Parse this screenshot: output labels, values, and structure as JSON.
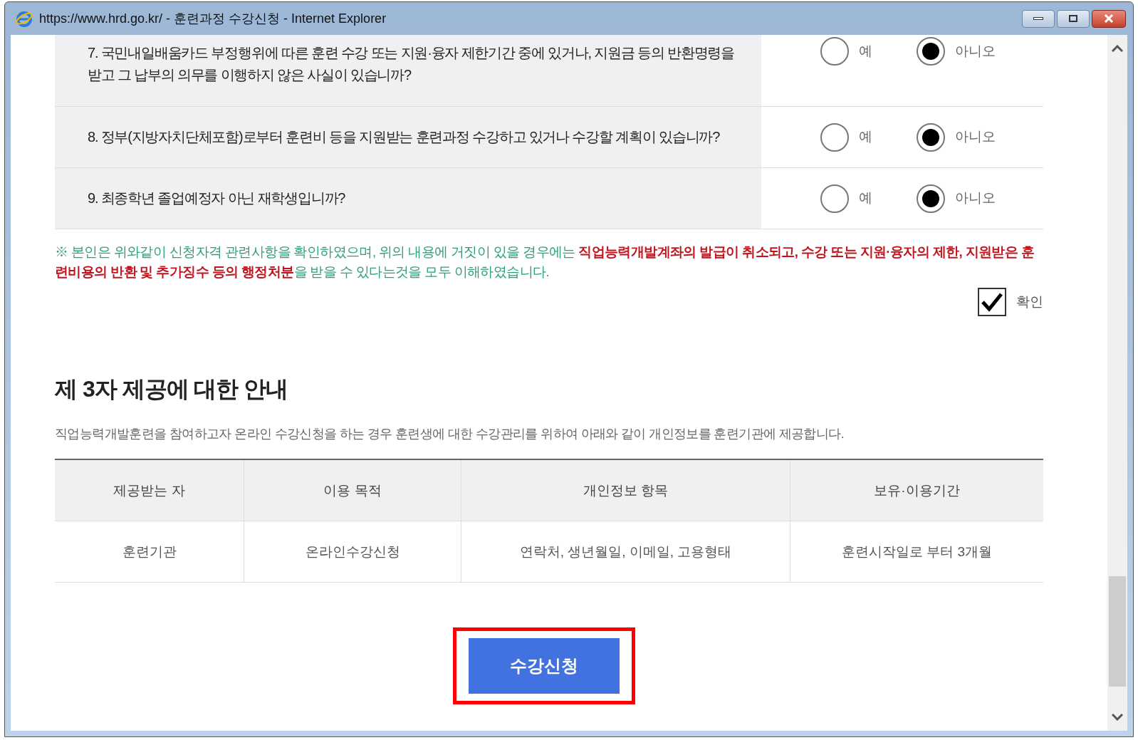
{
  "window": {
    "title": "https://www.hrd.go.kr/ - 훈련과정 수강신청 - Internet Explorer"
  },
  "questions": [
    {
      "text": "7. 국민내일배움카드 부정행위에 따른 훈련 수강 또는 지원·융자 제한기간 중에 있거나, 지원금 등의 반환명령을 받고 그 납부의 의무를 이행하지 않은 사실이 있습니까?",
      "options": [
        {
          "label": "예",
          "selected": false
        },
        {
          "label": "아니오",
          "selected": true
        }
      ]
    },
    {
      "text": "8. 정부(지방자치단체포함)로부터 훈련비 등을 지원받는 훈련과정 수강하고 있거나 수강할 계획이 있습니까?",
      "options": [
        {
          "label": "예",
          "selected": false
        },
        {
          "label": "아니오",
          "selected": true
        }
      ]
    },
    {
      "text": "9. 최종학년 졸업예정자 아닌 재학생입니까?",
      "options": [
        {
          "label": "예",
          "selected": false
        },
        {
          "label": "아니오",
          "selected": true
        }
      ]
    }
  ],
  "notice": {
    "text": "※ 본인은 위와같이 신청자격 관련사항을 확인하였으며, 위의 내용에 거짓이 있을 경우에는 **직업능력개발계좌의 발급이 취소되고, 수강 또는 지원·융자의 제한, 지원받은 훈련비용의 반환 및 추가징수 등의 행정처분**을 받을 수 있다는것을 모두 이해하였습니다.",
    "confirm": {
      "label": "확인",
      "checked": true
    }
  },
  "third_party": {
    "title": "제 3자 제공에 대한 안내",
    "description": "직업능력개발훈련을 참여하고자 온라인 수강신청을 하는 경우 훈련생에 대한 수강관리를 위하여 아래와 같이 개인정보를 훈련기관에 제공합니다.",
    "table": {
      "columns": [
        "제공받는 자",
        "이용 목적",
        "개인정보 항목",
        "보유·이용기간"
      ],
      "rows": [
        [
          "훈련기관",
          "온라인수강신청",
          "연락처, 생년월일, 이메일, 고용형태",
          "훈련시작일로 부터 3개월"
        ]
      ]
    }
  },
  "submit_button": "수강신청"
}
